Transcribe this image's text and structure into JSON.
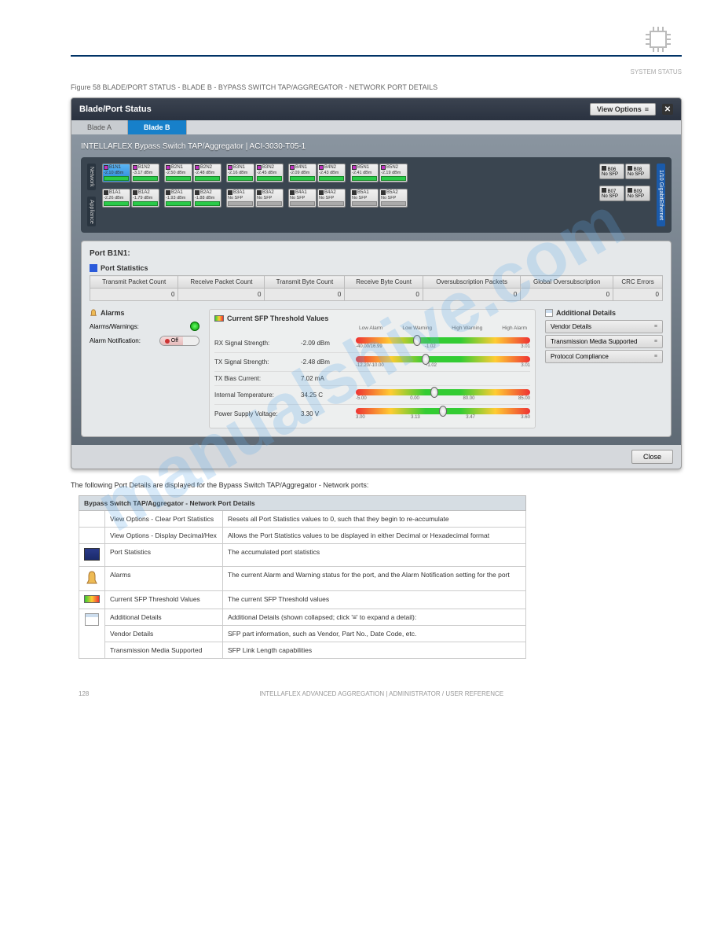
{
  "header": {
    "section": "SYSTEM STATUS"
  },
  "figure_caption": "Figure 58  BLADE/PORT STATUS - BLADE B - BYPASS SWITCH TAP/AGGREGATOR - NETWORK PORT DETAILS",
  "window": {
    "title": "Blade/Port Status",
    "view_options": "View Options",
    "tabs": {
      "a": "Blade A",
      "b": "Blade B"
    },
    "subtitle": "INTELLAFLEX Bypass Switch TAP/Aggregator  |  ACI-3030-T05-1",
    "network_label": "Network",
    "appliance_label": "Appliance",
    "gig_label": "1/10 GigabitEthernet",
    "network_ports": [
      [
        {
          "name": "B1N1",
          "val": "-2.10 dBm",
          "sel": true
        },
        {
          "name": "B1N2",
          "val": "-3.17 dBm"
        }
      ],
      [
        {
          "name": "B2N1",
          "val": "-2.50 dBm"
        },
        {
          "name": "B2N2",
          "val": "-2.48 dBm"
        }
      ],
      [
        {
          "name": "B3N1",
          "val": "-2.16 dBm"
        },
        {
          "name": "B3N2",
          "val": "-2.45 dBm"
        }
      ],
      [
        {
          "name": "B4N1",
          "val": "-2.09 dBm"
        },
        {
          "name": "B4N2",
          "val": "-2.43 dBm"
        }
      ],
      [
        {
          "name": "B5N1",
          "val": "-2.41 dBm"
        },
        {
          "name": "B5N2",
          "val": "-2.19 dBm"
        }
      ]
    ],
    "appliance_ports": [
      [
        {
          "name": "B1A1",
          "val": "-2.26 dBm"
        },
        {
          "name": "B1A2",
          "val": "-1.79 dBm"
        }
      ],
      [
        {
          "name": "B2A1",
          "val": "-1.93 dBm"
        },
        {
          "name": "B2A2",
          "val": "-1.88 dBm"
        }
      ],
      [
        {
          "name": "B3A1",
          "val": "No SFP",
          "grey": true
        },
        {
          "name": "B3A2",
          "val": "No SFP",
          "grey": true
        }
      ],
      [
        {
          "name": "B4A1",
          "val": "No SFP",
          "grey": true
        },
        {
          "name": "B4A2",
          "val": "No SFP",
          "grey": true
        }
      ],
      [
        {
          "name": "B5A1",
          "val": "No SFP",
          "grey": true
        },
        {
          "name": "B5A2",
          "val": "No SFP",
          "grey": true
        }
      ]
    ],
    "right_ports": [
      [
        {
          "name": "B06",
          "val": "No SFP"
        },
        {
          "name": "B08",
          "val": "No SFP"
        }
      ],
      [
        {
          "name": "B07",
          "val": "No SFP"
        },
        {
          "name": "B09",
          "val": "No SFP"
        }
      ]
    ]
  },
  "detail": {
    "port_title": "Port B1N1:",
    "stats_header": "Port Statistics",
    "stats_columns": [
      "Transmit Packet Count",
      "Receive Packet Count",
      "Transmit Byte Count",
      "Receive Byte Count",
      "Oversubscription Packets",
      "Global Oversubscription",
      "CRC Errors"
    ],
    "stats_values": [
      "0",
      "0",
      "0",
      "0",
      "0",
      "0",
      "0"
    ],
    "alarms": {
      "header": "Alarms",
      "warnings_label": "Alarms/Warnings:",
      "notification_label": "Alarm Notification:",
      "toggle_off": "Off"
    },
    "sfp": {
      "header": "Current SFP Threshold Values",
      "col_labels": [
        "Low Alarm",
        "Low Warning",
        "High Warning",
        "High Alarm"
      ],
      "rows": [
        {
          "label": "RX Signal Strength:",
          "value": "-2.09 dBm",
          "ticks": [
            "-40.00/16.99",
            "-1.02",
            "",
            "3.01"
          ],
          "pos": 35
        },
        {
          "label": "TX Signal Strength:",
          "value": "-2.48 dBm",
          "ticks": [
            "-12.20/-10.00",
            "-1.02",
            "",
            "3.01"
          ],
          "pos": 40
        },
        {
          "label": "TX Bias Current:",
          "value": "7.02 mA",
          "ticks": [
            "",
            "",
            "",
            ""
          ],
          "pos": -1
        },
        {
          "label": "Internal Temperature:",
          "value": "34.25 C",
          "ticks": [
            "-5.00",
            "0.00",
            "80.00",
            "85.00"
          ],
          "pos": 45
        },
        {
          "label": "Power Supply Voltage:",
          "value": "3.30 V",
          "ticks": [
            "3.00",
            "3.13",
            "3.47",
            "3.60"
          ],
          "pos": 50
        }
      ]
    },
    "additional": {
      "header": "Additional Details",
      "items": [
        "Vendor Details",
        "Transmission Media Supported",
        "Protocol Compliance"
      ]
    },
    "close": "Close"
  },
  "desc_intro": "The following Port Details are displayed for the Bypass Switch TAP/Aggregator - Network ports:",
  "desc_table": {
    "header": "Bypass Switch TAP/Aggregator - Network Port Details",
    "rows": [
      {
        "icon": "",
        "name": "View Options - Clear Port Statistics",
        "desc": "Resets all Port Statistics values to 0, such that they begin to re-accumulate"
      },
      {
        "icon": "",
        "name": "View Options - Display Decimal/Hex",
        "desc": "Allows the Port Statistics values to be displayed in either Decimal or Hexadecimal format"
      },
      {
        "icon": "screen",
        "name": "Port Statistics",
        "desc": "The accumulated port statistics"
      },
      {
        "icon": "bell",
        "name": "Alarms",
        "desc": "The current Alarm and Warning status for the port, and the Alarm Notification setting for the port"
      },
      {
        "icon": "bar",
        "name": "Current SFP Threshold Values",
        "desc": "The current SFP Threshold values"
      },
      {
        "icon": "table",
        "name": "Additional Details",
        "desc": "Additional Details (shown collapsed; click '≡' to expand a detail):"
      },
      {
        "icon": "",
        "name": "Vendor Details",
        "desc": "SFP part information, such as Vendor, Part No., Date Code, etc."
      },
      {
        "icon": "",
        "name": "Transmission Media Supported",
        "desc": "SFP Link Length capabilities"
      }
    ]
  },
  "watermark": "manualshive.com",
  "footer": {
    "left": "128",
    "center": "INTELLAFLEX ADVANCED AGGREGATION  |  ADMINISTRATOR / USER REFERENCE"
  }
}
